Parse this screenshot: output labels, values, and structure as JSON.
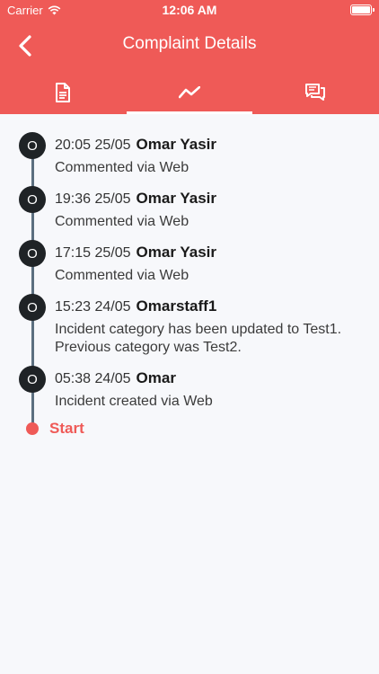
{
  "status_bar": {
    "carrier": "Carrier",
    "time": "12:06 AM"
  },
  "nav": {
    "title": "Complaint Details"
  },
  "tabs": [
    {
      "icon": "document-icon"
    },
    {
      "icon": "timeline-icon",
      "active": true
    },
    {
      "icon": "chat-icon"
    }
  ],
  "timeline": {
    "events": [
      {
        "avatar": "O",
        "time": "20:05 25/05",
        "user": "Omar Yasir",
        "text": "Commented via Web"
      },
      {
        "avatar": "O",
        "time": "19:36 25/05",
        "user": "Omar Yasir",
        "text": "Commented via Web"
      },
      {
        "avatar": "O",
        "time": "17:15 25/05",
        "user": "Omar Yasir",
        "text": "Commented via Web"
      },
      {
        "avatar": "O",
        "time": "15:23 24/05",
        "user": "Omarstaff1",
        "text": "Incident category has been updated to Test1. Previous category was Test2."
      },
      {
        "avatar": "O",
        "time": "05:38 24/05",
        "user": "Omar",
        "text": "Incident created via Web"
      }
    ],
    "start_label": "Start"
  },
  "colors": {
    "accent": "#ef5a57",
    "avatar_bg": "#1f2326",
    "line": "#5c6f80",
    "background": "#f7f8fb"
  }
}
